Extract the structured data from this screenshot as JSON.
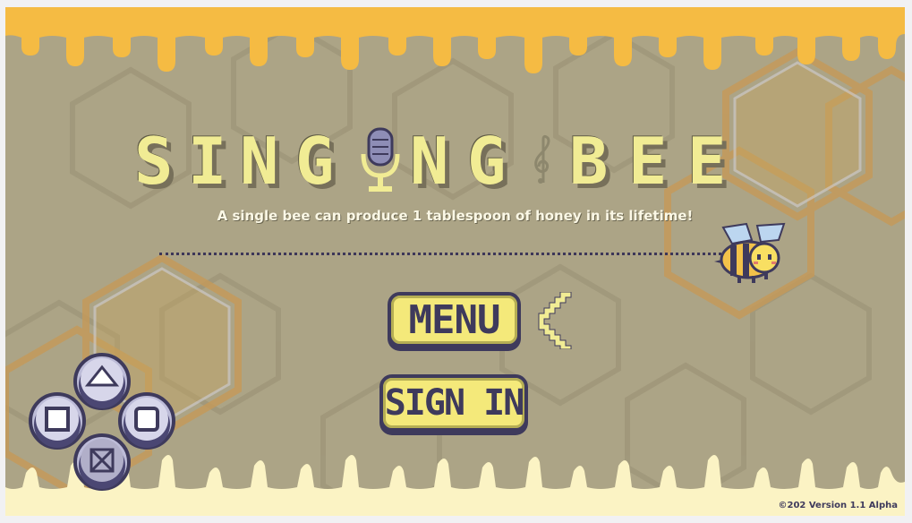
{
  "game": {
    "title_letters": [
      "S",
      "I",
      "N",
      "G",
      "I",
      "N",
      "G",
      "B",
      "E",
      "E"
    ],
    "fun_fact": "A single bee can produce 1 tablespoon of honey in its lifetime!",
    "menu_label": "MENU",
    "signin_label": "SIGN IN",
    "version": "©202 Version 1.1 Alpha"
  },
  "icons": {
    "title_i_replacement": "microphone-icon",
    "decoration_between_words": "treble-clef-icon",
    "mascot": "bee-icon",
    "selection_cursor": "left-arrow-icon",
    "controller_buttons": [
      "triangle-icon",
      "square-icon",
      "circle-icon",
      "cross-icon"
    ]
  },
  "colors": {
    "background": "#aca486",
    "honey": "#f5bb43",
    "honey_light": "#fbf3c4",
    "title": "#f1ec94",
    "button_fill": "#f4e97a",
    "outline": "#3e3a5c"
  }
}
